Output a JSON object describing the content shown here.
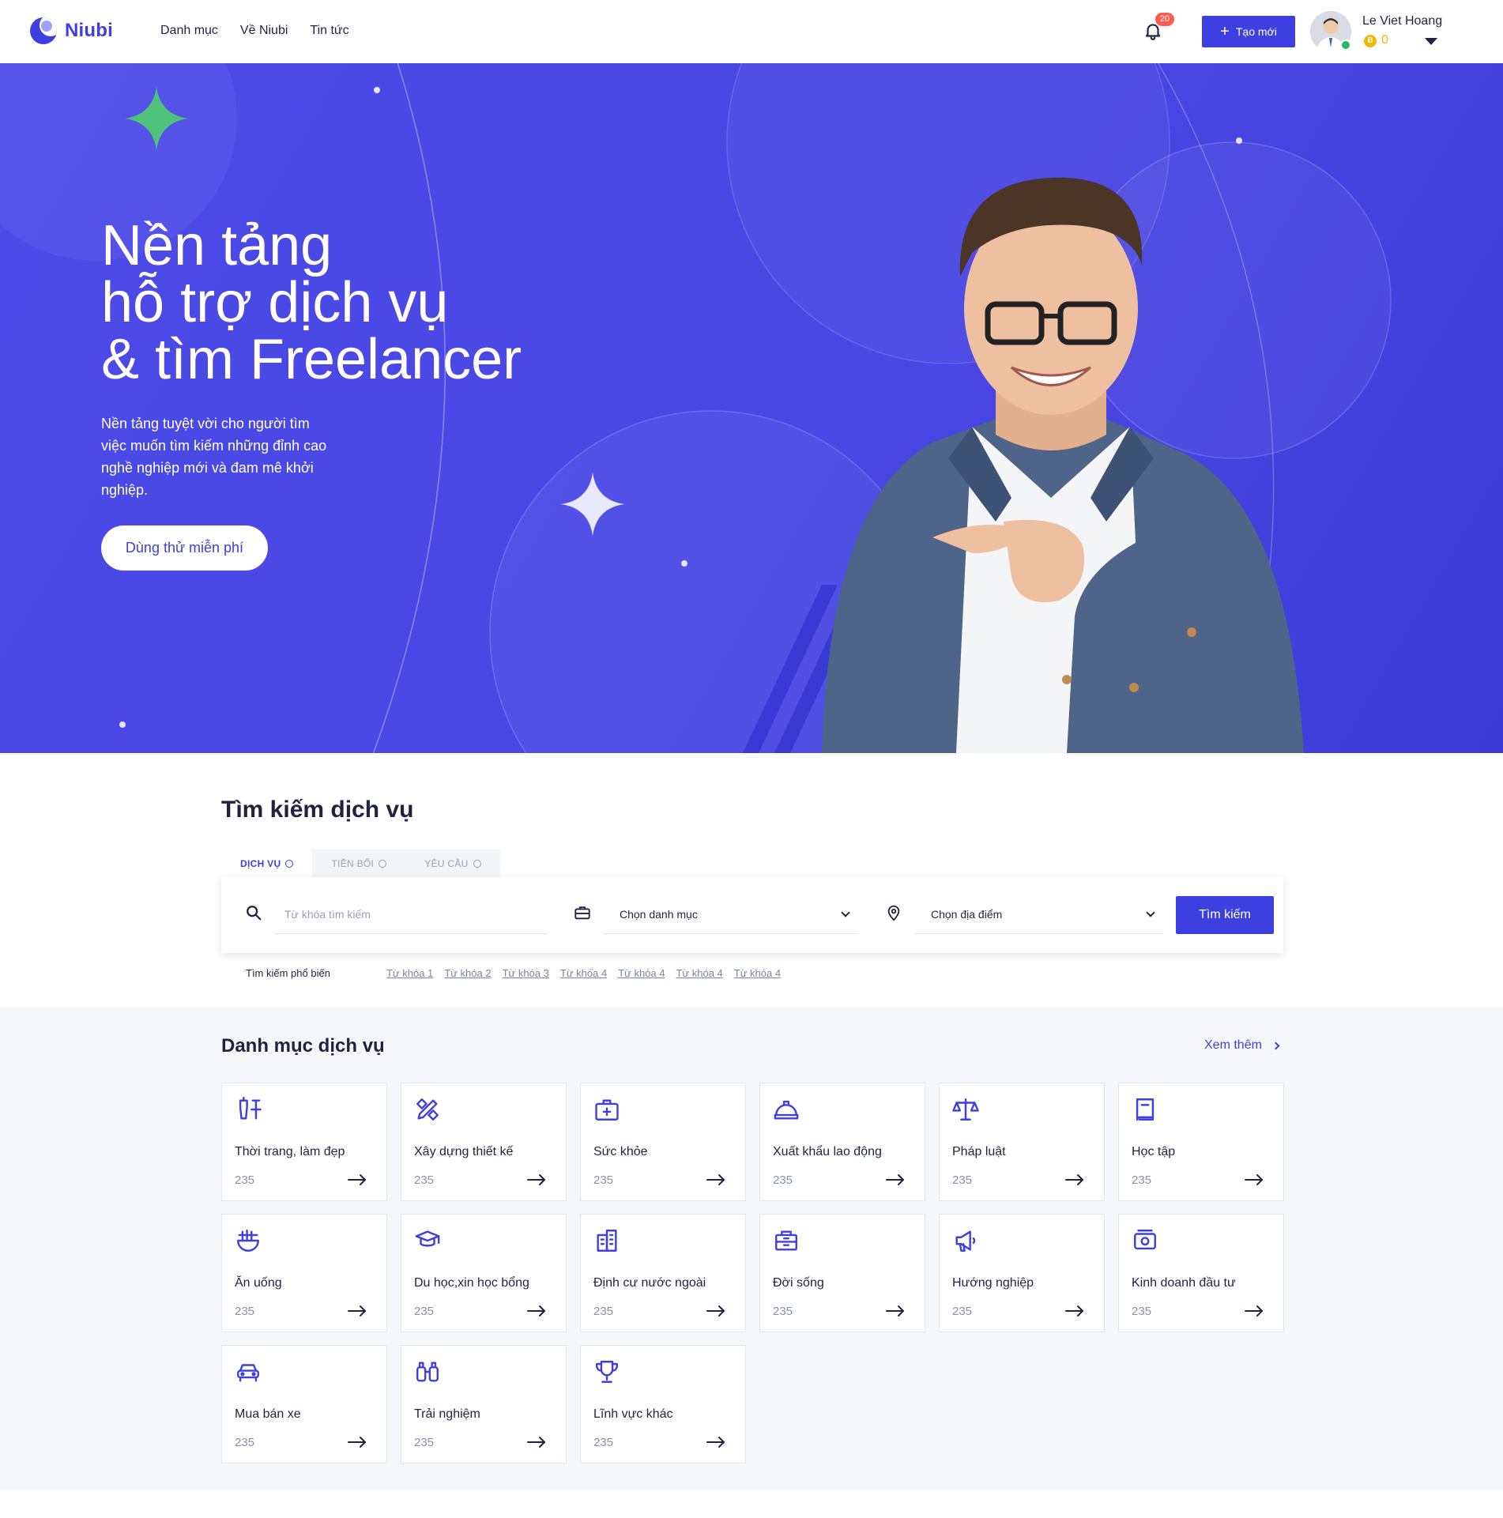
{
  "header": {
    "logo_text": "Niubi",
    "nav": [
      "Danh mục",
      "Về Niubi",
      "Tin tức"
    ],
    "notification_count": "20",
    "create_label": "Tạo mới",
    "user_name": "Le Viet Hoang",
    "coin_symbol": "B",
    "coin_count": "0"
  },
  "hero": {
    "title_lines": [
      "Nền tảng",
      "hỗ trợ dịch vụ",
      "& tìm Freelancer"
    ],
    "description": "Nền tảng tuyệt vời cho người tìm việc muốn tìm kiếm những đỉnh cao nghề nghiệp mới và đam mê khởi nghiệp.",
    "cta_label": "Dùng thử miễn phí"
  },
  "search": {
    "title": "Tìm kiếm dịch vụ",
    "tabs": [
      "DỊCH VỤ",
      "TIỀN BỐI",
      "YÊU CẦU"
    ],
    "keyword_placeholder": "Từ khóa tìm kiếm",
    "category_value": "Chọn danh mục",
    "location_value": "Chọn địa điểm",
    "button_label": "Tìm kiếm",
    "popular_label": "Tìm kiếm phổ biến",
    "popular_keywords": [
      "Từ khóa 1",
      "Từ khóa 2",
      "Từ khóa 3",
      "Từ khóa 4",
      "Từ khóa 4",
      "Từ khóa 4",
      "Từ khóa 4"
    ]
  },
  "categories": {
    "title": "Danh mục dịch vụ",
    "more_label": "Xem thêm",
    "accent_color": "#3d3fe0",
    "items": [
      {
        "label": "Thời trang, làm đẹp",
        "count": "235",
        "icon": "beauty-icon"
      },
      {
        "label": "Xây dựng thiết kế",
        "count": "235",
        "icon": "design-tools-icon"
      },
      {
        "label": "Sức khỏe",
        "count": "235",
        "icon": "first-aid-icon"
      },
      {
        "label": "Xuất khẩu lao động",
        "count": "235",
        "icon": "hard-hat-icon"
      },
      {
        "label": "Pháp luật",
        "count": "235",
        "icon": "scales-icon"
      },
      {
        "label": "Học tập",
        "count": "235",
        "icon": "book-icon"
      },
      {
        "label": "Ăn uống",
        "count": "235",
        "icon": "noodle-bowl-icon"
      },
      {
        "label": "Du học,xin học bổng",
        "count": "235",
        "icon": "graduation-cap-icon"
      },
      {
        "label": "Định cư nước ngoài",
        "count": "235",
        "icon": "buildings-icon"
      },
      {
        "label": "Đời sống",
        "count": "235",
        "icon": "cabinet-icon"
      },
      {
        "label": "Hướng nghiệp",
        "count": "235",
        "icon": "megaphone-icon"
      },
      {
        "label": "Kinh doanh đầu tư",
        "count": "235",
        "icon": "money-icon"
      },
      {
        "label": "Mua bán xe",
        "count": "235",
        "icon": "car-icon"
      },
      {
        "label": "Trải nghiệm",
        "count": "235",
        "icon": "binoculars-icon"
      },
      {
        "label": "Lĩnh vực khác",
        "count": "235",
        "icon": "trophy-icon"
      }
    ]
  }
}
